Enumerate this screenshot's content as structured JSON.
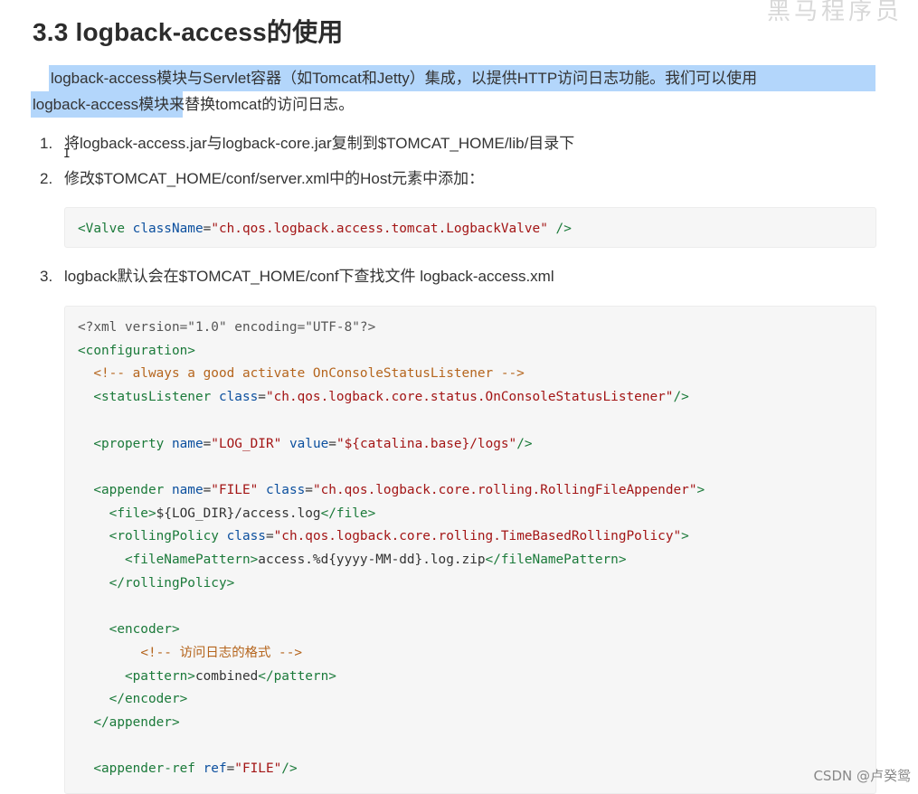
{
  "heading": "3.3 logback-access的使用",
  "watermark_top": "黑马程序员",
  "paragraph": {
    "line1": "logback-access模块与Servlet容器（如Tomcat和Jetty）集成，以提供HTTP访问日志功能。我们可以使用",
    "line2_highlighted": "logback-access模块",
    "line2_rest": "来替换tomcat的访问日志。"
  },
  "steps": [
    {
      "num": "1.",
      "text": "将logback-access.jar与logback-core.jar复制到$TOMCAT_HOME/lib/目录下"
    },
    {
      "num": "2.",
      "text": "修改$TOMCAT_HOME/conf/server.xml中的Host元素中添加："
    },
    {
      "num": "3.",
      "text": "logback默认会在$TOMCAT_HOME/conf下查找文件 logback-access.xml"
    }
  ],
  "code1": [
    [
      [
        "tag",
        "<Valve "
      ],
      [
        "attr",
        "className"
      ],
      [
        "pln",
        "="
      ],
      [
        "str",
        "\"ch.qos.logback.access.tomcat.LogbackValve\""
      ],
      [
        "tag",
        " />"
      ]
    ]
  ],
  "code2": [
    [
      [
        "pi",
        "<?xml version=\"1.0\" encoding=\"UTF-8\"?>"
      ]
    ],
    [
      [
        "tag",
        "<configuration>"
      ]
    ],
    [
      [
        "pln",
        "  "
      ],
      [
        "cmt",
        "<!-- always a good activate OnConsoleStatusListener -->"
      ]
    ],
    [
      [
        "pln",
        "  "
      ],
      [
        "tag",
        "<statusListener "
      ],
      [
        "attr",
        "class"
      ],
      [
        "pln",
        "="
      ],
      [
        "str",
        "\"ch.qos.logback.core.status.OnConsoleStatusListener\""
      ],
      [
        "tag",
        "/>"
      ]
    ],
    [],
    [
      [
        "pln",
        "  "
      ],
      [
        "tag",
        "<property "
      ],
      [
        "attr",
        "name"
      ],
      [
        "pln",
        "="
      ],
      [
        "str",
        "\"LOG_DIR\""
      ],
      [
        "pln",
        " "
      ],
      [
        "attr",
        "value"
      ],
      [
        "pln",
        "="
      ],
      [
        "str",
        "\"${catalina.base}/logs\""
      ],
      [
        "tag",
        "/>"
      ]
    ],
    [],
    [
      [
        "pln",
        "  "
      ],
      [
        "tag",
        "<appender "
      ],
      [
        "attr",
        "name"
      ],
      [
        "pln",
        "="
      ],
      [
        "str",
        "\"FILE\""
      ],
      [
        "pln",
        " "
      ],
      [
        "attr",
        "class"
      ],
      [
        "pln",
        "="
      ],
      [
        "str",
        "\"ch.qos.logback.core.rolling.RollingFileAppender\""
      ],
      [
        "tag",
        ">"
      ]
    ],
    [
      [
        "pln",
        "    "
      ],
      [
        "tag",
        "<file>"
      ],
      [
        "pln",
        "${LOG_DIR}/access.log"
      ],
      [
        "tag",
        "</file>"
      ]
    ],
    [
      [
        "pln",
        "    "
      ],
      [
        "tag",
        "<rollingPolicy "
      ],
      [
        "attr",
        "class"
      ],
      [
        "pln",
        "="
      ],
      [
        "str",
        "\"ch.qos.logback.core.rolling.TimeBasedRollingPolicy\""
      ],
      [
        "tag",
        ">"
      ]
    ],
    [
      [
        "pln",
        "      "
      ],
      [
        "tag",
        "<fileNamePattern>"
      ],
      [
        "pln",
        "access.%d{yyyy-MM-dd}.log.zip"
      ],
      [
        "tag",
        "</fileNamePattern>"
      ]
    ],
    [
      [
        "pln",
        "    "
      ],
      [
        "tag",
        "</rollingPolicy>"
      ]
    ],
    [],
    [
      [
        "pln",
        "    "
      ],
      [
        "tag",
        "<encoder>"
      ]
    ],
    [
      [
        "pln",
        "        "
      ],
      [
        "cmt",
        "<!-- 访问日志的格式 -->"
      ]
    ],
    [
      [
        "pln",
        "      "
      ],
      [
        "tag",
        "<pattern>"
      ],
      [
        "pln",
        "combined"
      ],
      [
        "tag",
        "</pattern>"
      ]
    ],
    [
      [
        "pln",
        "    "
      ],
      [
        "tag",
        "</encoder>"
      ]
    ],
    [
      [
        "pln",
        "  "
      ],
      [
        "tag",
        "</appender>"
      ]
    ],
    [],
    [
      [
        "pln",
        "  "
      ],
      [
        "tag",
        "<appender-ref "
      ],
      [
        "attr",
        "ref"
      ],
      [
        "pln",
        "="
      ],
      [
        "str",
        "\"FILE\""
      ],
      [
        "tag",
        "/>"
      ]
    ]
  ],
  "csdn_watermark": "CSDN @卢癸鸳",
  "colors": {
    "highlight": "#b3d6fb",
    "tag": "#1b7a3a",
    "attr": "#0b4f9e",
    "string": "#a31515",
    "comment": "#b5651d",
    "code_bg": "#f6f6f6"
  }
}
